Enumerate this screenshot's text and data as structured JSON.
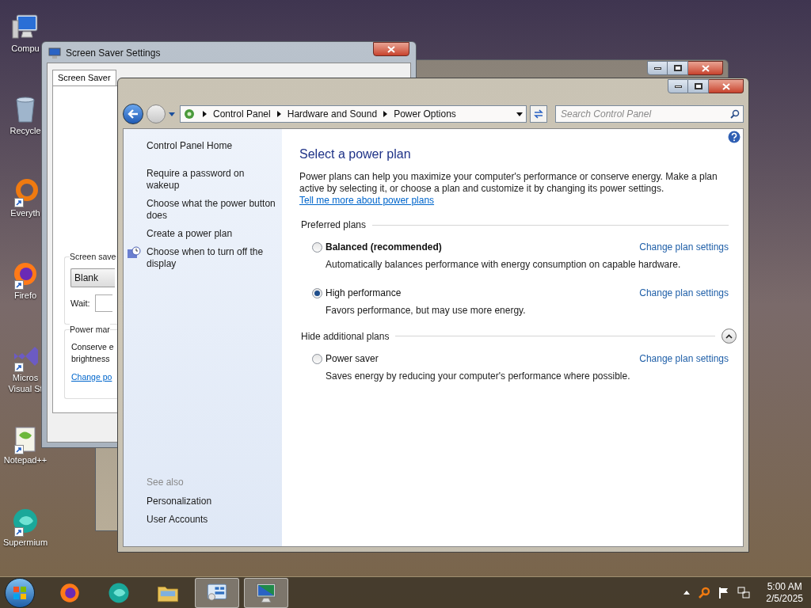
{
  "desktop_icons": [
    {
      "label": "Compu",
      "kind": "computer",
      "shortcut": false
    },
    {
      "label": "Recycle",
      "kind": "bin",
      "shortcut": false
    },
    {
      "label": "Everyth",
      "kind": "ring",
      "shortcut": true
    },
    {
      "label": "Firefo",
      "kind": "firefox",
      "shortcut": true
    },
    {
      "label": "Micros Visual St",
      "kind": "studio",
      "shortcut": true
    },
    {
      "label": "Notepad++",
      "kind": "notepad",
      "shortcut": true
    },
    {
      "label": "Supermium",
      "kind": "supermium",
      "shortcut": true
    }
  ],
  "screen_saver_window": {
    "title": "Screen Saver Settings",
    "tabs": [
      {
        "label": "Screen Saver",
        "selected": true
      }
    ],
    "screen_saver_group": {
      "legend": "Screen save",
      "selection": "Blank",
      "wait_label": "Wait:"
    },
    "power_group": {
      "legend": "Power mar",
      "text_lines": [
        "Conserve e",
        "brightness"
      ],
      "link": "Change po"
    }
  },
  "power_options_window": {
    "breadcrumb": [
      "Control Panel",
      "Hardware and Sound",
      "Power Options"
    ],
    "search": {
      "placeholder": "Search Control Panel"
    },
    "sidebar": {
      "tasks": [
        {
          "label": "Control Panel Home",
          "kind": "home"
        },
        {
          "label": "Require a password on wakeup",
          "kind": "link"
        },
        {
          "label": "Choose what the power button does",
          "kind": "link"
        },
        {
          "label": "Create a power plan",
          "kind": "link"
        },
        {
          "label": "Choose when to turn off the display",
          "kind": "icon-link"
        }
      ],
      "see_also_heading": "See also",
      "see_also": [
        "Personalization",
        "User Accounts"
      ]
    },
    "heading": "Select a power plan",
    "intro": "Power plans can help you maximize your computer's performance or conserve energy. Make a plan active by selecting it, or choose a plan and customize it by changing its power settings.",
    "intro_link": "Tell me more about power plans",
    "groups": [
      {
        "title": "Preferred plans",
        "collapse_button": false,
        "plans": [
          {
            "name": "Balanced (recommended)",
            "emphasized": true,
            "selected": false,
            "description": "Automatically balances performance with energy consumption on capable hardware.",
            "link": "Change plan settings"
          },
          {
            "name": "High performance",
            "emphasized": false,
            "selected": true,
            "description": "Favors performance, but may use more energy.",
            "link": "Change plan settings"
          }
        ]
      },
      {
        "title": "Hide additional plans",
        "collapse_button": true,
        "plans": [
          {
            "name": "Power saver",
            "emphasized": false,
            "selected": false,
            "description": "Saves energy by reducing your computer's performance where possible.",
            "link": "Change plan settings"
          }
        ]
      }
    ]
  },
  "taskbar": {
    "buttons": [
      {
        "kind": "firefox",
        "active": false
      },
      {
        "kind": "supermium",
        "active": false
      },
      {
        "kind": "folder",
        "active": false
      },
      {
        "kind": "control-panel",
        "active": true
      },
      {
        "kind": "display",
        "active": true
      }
    ],
    "clock": {
      "time": "5:00 AM",
      "date": "2/5/2025"
    }
  }
}
